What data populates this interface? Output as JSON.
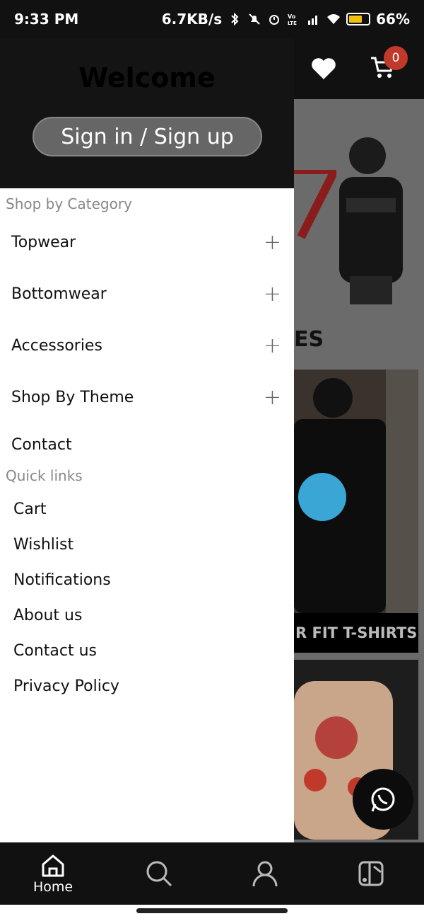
{
  "status_bar": {
    "time": "9:33 PM",
    "net_speed": "6.7KB/s",
    "battery": "66%",
    "icons": [
      "bluetooth-icon",
      "mute-icon",
      "alarm-icon",
      "volte-icon",
      "signal-icon",
      "wifi-icon",
      "battery-icon"
    ]
  },
  "header": {
    "cart_count": "0",
    "icons": [
      "heart-icon",
      "cart-icon"
    ]
  },
  "background": {
    "section_title": "ES",
    "card_caption": "R FIT T-SHIRTS"
  },
  "drawer": {
    "welcome": "Welcome",
    "signin_label": "Sign in / Sign up",
    "shop_heading": "Shop by Category",
    "categories": [
      {
        "label": "Topwear",
        "action": "+"
      },
      {
        "label": "Bottomwear",
        "action": "+"
      },
      {
        "label": "Accessories",
        "action": "+"
      },
      {
        "label": "Shop By Theme",
        "action": "+"
      }
    ],
    "contact_label": "Contact",
    "quick_heading": "Quick links",
    "quick_links": [
      "Cart",
      "Wishlist",
      "Notifications",
      "About us",
      "Contact us",
      "Privacy Policy"
    ]
  },
  "bottom_nav": {
    "items": [
      {
        "icon": "home-icon",
        "label": "Home"
      },
      {
        "icon": "search-icon",
        "label": ""
      },
      {
        "icon": "profile-icon",
        "label": ""
      },
      {
        "icon": "catalog-icon",
        "label": ""
      }
    ]
  },
  "colors": {
    "accent_badge": "#c0392b",
    "drawer_header": "#141414",
    "battery": "#f2c20a"
  }
}
